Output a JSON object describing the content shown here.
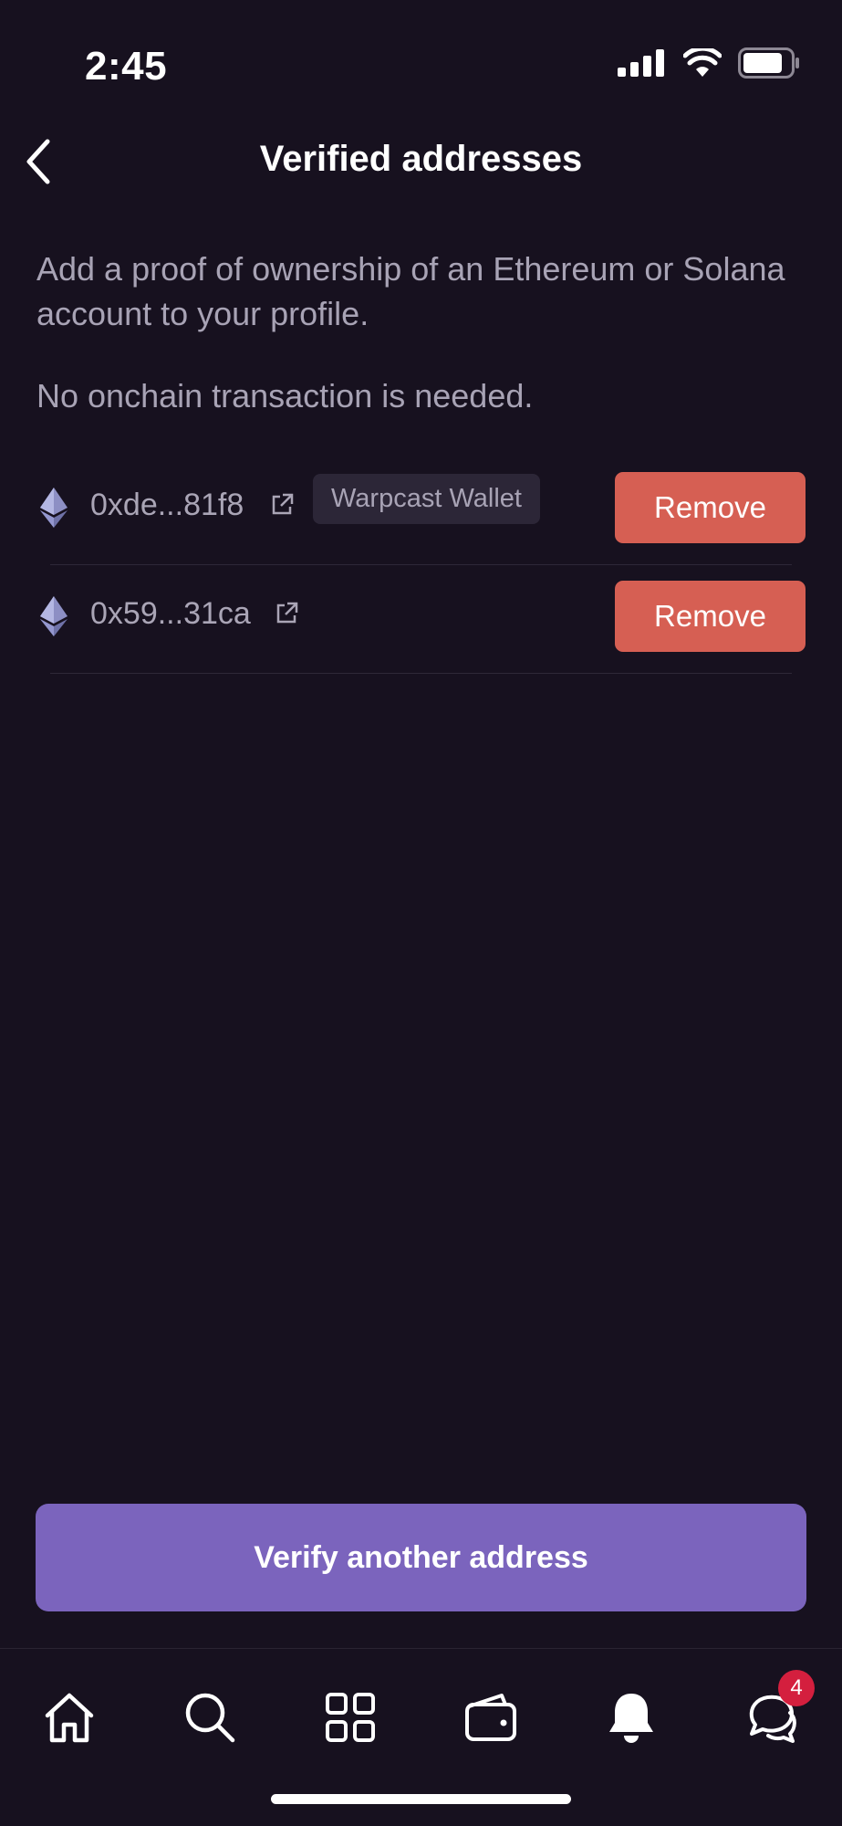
{
  "status_bar": {
    "time": "2:45"
  },
  "header": {
    "title": "Verified addresses",
    "back_icon": "chevron-left-icon"
  },
  "description": {
    "line1": "Add a proof of ownership of an Ethereum or Solana account to your profile.",
    "line2": "No onchain transaction is needed."
  },
  "addresses": [
    {
      "address": "0xde...81f8",
      "badge": "Warpcast Wallet",
      "remove_label": "Remove",
      "chain_icon": "ethereum-icon"
    },
    {
      "address": "0x59...31ca",
      "remove_label": "Remove",
      "chain_icon": "ethereum-icon"
    }
  ],
  "verify_button": {
    "label": "Verify another address"
  },
  "tabbar": {
    "items": [
      {
        "icon": "home-icon"
      },
      {
        "icon": "search-icon"
      },
      {
        "icon": "grid-icon"
      },
      {
        "icon": "wallet-icon"
      },
      {
        "icon": "bell-icon"
      },
      {
        "icon": "chat-icon"
      }
    ],
    "notification_count": "4"
  },
  "colors": {
    "background": "#17111f",
    "remove": "#d65f53",
    "primary": "#7b64bd",
    "badge_red": "#d41f3e"
  }
}
